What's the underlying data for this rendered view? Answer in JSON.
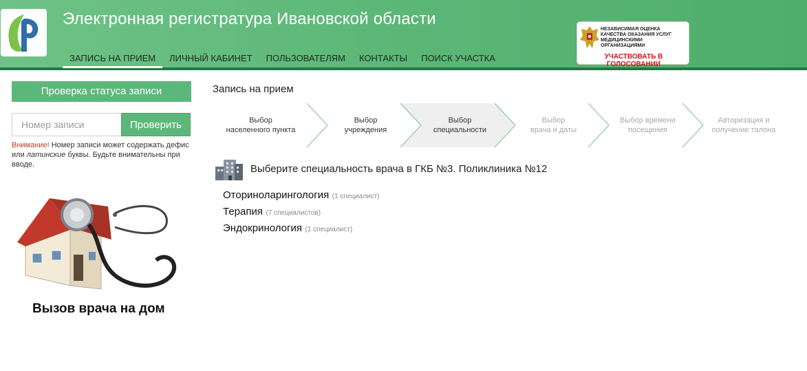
{
  "header": {
    "title": "Электронная регистратура Ивановской области",
    "logo_icon": "leaf-p-logo-icon",
    "brand_color": "#5cb87a",
    "nav": [
      {
        "label": "ЗАПИСЬ НА ПРИЕМ",
        "active": true
      },
      {
        "label": "ЛИЧНЫЙ КАБИНЕТ",
        "active": false
      },
      {
        "label": "ПОЛЬЗОВАТЕЛЯМ",
        "active": false
      },
      {
        "label": "КОНТАКТЫ",
        "active": false
      },
      {
        "label": "ПОИСК УЧАСТКА",
        "active": false
      }
    ],
    "vote_badge": {
      "line1": "НЕЗАВИСИМАЯ ОЦЕНКА",
      "line2": "КАЧЕСТВА ОКАЗАНИЯ УСЛУГ",
      "line3": "МЕДИЦИНСКИМИ ОРГАНИЗАЦИЯМИ",
      "link": "УЧАСТВОВАТЬ В ГОЛОСОВАНИИ",
      "icon": "coat-of-arms-icon"
    }
  },
  "sidebar": {
    "status_heading": "Проверка статуса записи",
    "record_input_placeholder": "Номер записи",
    "check_button": "Проверить",
    "hint": {
      "warning_word": "Внимание!",
      "text_before": " Номер записи может содержать дефис или ",
      "italic": "латинские",
      "text_after": " буквы. Будьте внимательны при вводе."
    },
    "promo_caption": "Вызов врача на дом"
  },
  "main": {
    "section_title": "Запись на прием",
    "steps": [
      {
        "line1": "Выбор",
        "line2": "населенного пункта",
        "state": "done"
      },
      {
        "line1": "Выбор",
        "line2": "учреждения",
        "state": "done"
      },
      {
        "line1": "Выбор",
        "line2": "специальности",
        "state": "current"
      },
      {
        "line1": "Выбор",
        "line2": "врача и даты",
        "state": "todo"
      },
      {
        "line1": "Выбор времени",
        "line2": "посещения",
        "state": "todo"
      },
      {
        "line1": "Авторизация и",
        "line2": "получение талона",
        "state": "todo"
      }
    ],
    "clinic_title": "Выберите специальность врача в ГКБ №3. Поликлиника №12",
    "specialties": [
      {
        "name": "Оториноларингология",
        "count": "(1 специалист)"
      },
      {
        "name": "Терапия",
        "count": "(7 специалистов)"
      },
      {
        "name": "Эндокринология",
        "count": "(1 специалист)"
      }
    ]
  }
}
